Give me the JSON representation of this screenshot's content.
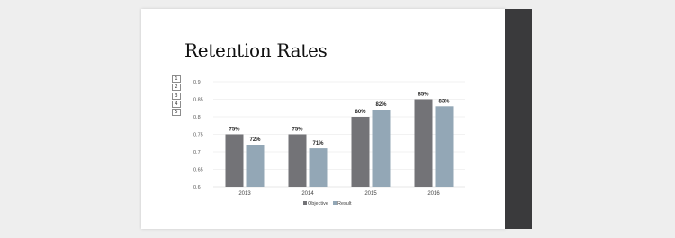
{
  "slide": {
    "title": "Retention Rates"
  },
  "outline_levels": [
    "1",
    "2",
    "3",
    "4",
    "5"
  ],
  "colors": {
    "objective": "#737377",
    "result": "#93a7b6"
  },
  "chart_data": {
    "type": "bar",
    "categories": [
      "2013",
      "2014",
      "2015",
      "2016"
    ],
    "series": [
      {
        "name": "Objective",
        "values": [
          0.75,
          0.75,
          0.8,
          0.85
        ],
        "labels": [
          "75%",
          "75%",
          "80%",
          "85%"
        ]
      },
      {
        "name": "Result",
        "values": [
          0.72,
          0.71,
          0.82,
          0.83
        ],
        "labels": [
          "72%",
          "71%",
          "82%",
          "83%"
        ]
      }
    ],
    "yticks": [
      "0.6",
      "0.65",
      "0.7",
      "0.75",
      "0.8",
      "0.85",
      "0.9"
    ],
    "ylim": [
      0.6,
      0.9
    ],
    "grid": true,
    "legend_position": "bottom"
  }
}
